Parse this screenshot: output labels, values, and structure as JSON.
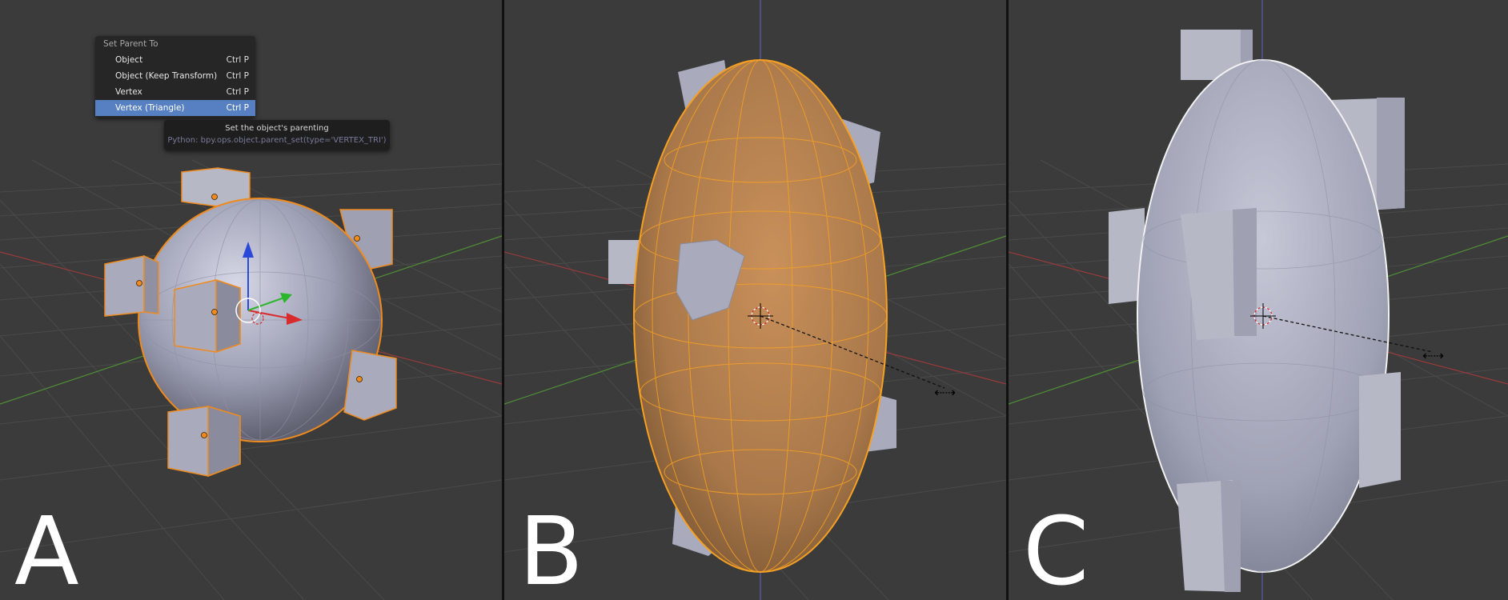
{
  "menu": {
    "title": "Set Parent To",
    "items": [
      {
        "label": "Object",
        "shortcut": "Ctrl P",
        "active": false
      },
      {
        "label": "Object (Keep Transform)",
        "shortcut": "Ctrl P",
        "active": false
      },
      {
        "label": "Vertex",
        "shortcut": "Ctrl P",
        "active": false
      },
      {
        "label": "Vertex (Triangle)",
        "shortcut": "Ctrl P",
        "active": true
      }
    ]
  },
  "tooltip": {
    "title": "Set the object's parenting",
    "python": "Python: bpy.ops.object.parent_set(type='VERTEX_TRI')"
  },
  "panels": [
    {
      "letter": "A"
    },
    {
      "letter": "B"
    },
    {
      "letter": "C"
    }
  ],
  "colors": {
    "viewport_bg": "#3b3b3b",
    "grid_line": "#4a4a4a",
    "x_axis": "#9a3a3a",
    "y_axis": "#4f8f35",
    "z_axis": "#5a5ab0",
    "selection": "#f08a1c",
    "mesh": "#a9abbd",
    "menu_highlight": "#5680c2"
  }
}
